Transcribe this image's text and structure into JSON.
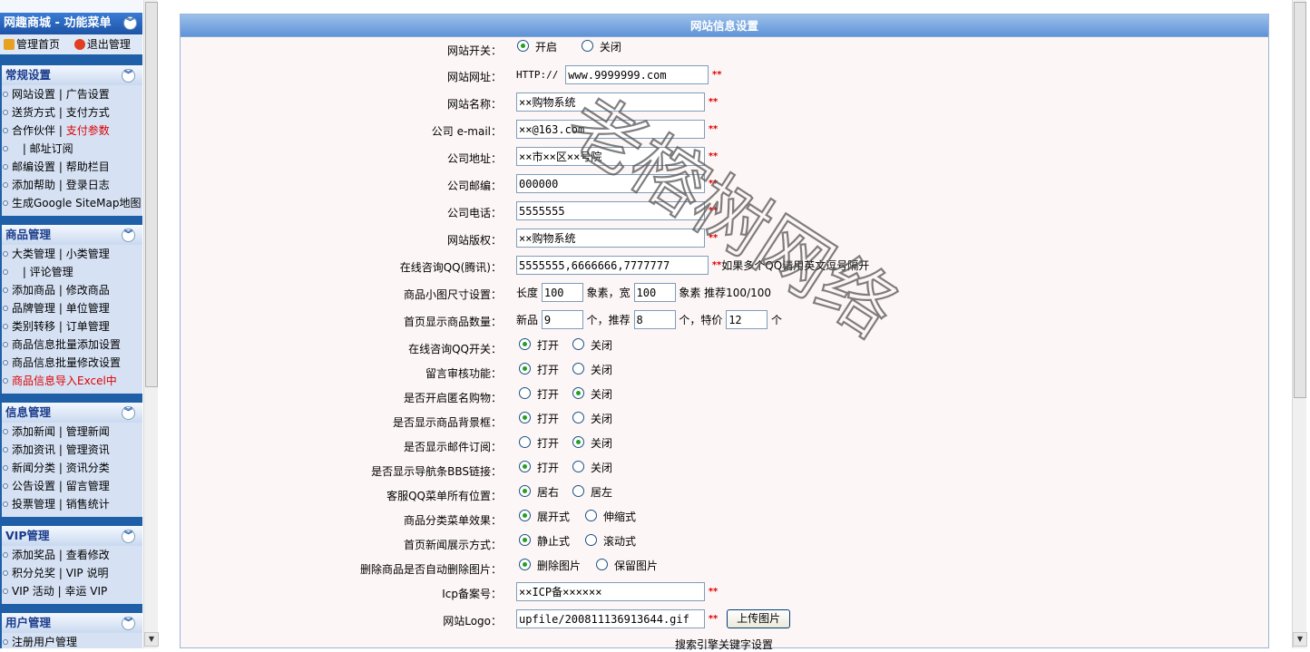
{
  "sidebar": {
    "title": "网趣商城 - 功能菜单",
    "top_links": [
      {
        "label": "管理首页",
        "icon": "home-icon"
      },
      {
        "label": "退出管理",
        "icon": "exit-icon"
      }
    ],
    "sections": [
      {
        "title": "常规设置",
        "items": [
          {
            "a": "网站设置",
            "b": "广告设置"
          },
          {
            "a": "送货方式",
            "b": "支付方式"
          },
          {
            "a": "合作伙伴",
            "b": "支付参数",
            "b_red": true
          },
          {
            "a": "",
            "b": "邮址订阅"
          },
          {
            "a": "邮编设置",
            "b": "帮助栏目"
          },
          {
            "a": "添加帮助",
            "b": "登录日志"
          },
          {
            "a": "生成Google SiteMap地图"
          }
        ]
      },
      {
        "title": "商品管理",
        "items": [
          {
            "a": "大类管理",
            "b": "小类管理"
          },
          {
            "a": "",
            "b": "评论管理"
          },
          {
            "a": "添加商品",
            "b": "修改商品"
          },
          {
            "a": "品牌管理",
            "b": "单位管理"
          },
          {
            "a": "类别转移",
            "b": "订单管理"
          },
          {
            "a": "商品信息批量添加设置"
          },
          {
            "a": "商品信息批量修改设置"
          },
          {
            "a": "商品信息导入Excel中",
            "a_red": true
          }
        ]
      },
      {
        "title": "信息管理",
        "items": [
          {
            "a": "添加新闻",
            "b": "管理新闻"
          },
          {
            "a": "添加资讯",
            "b": "管理资讯"
          },
          {
            "a": "新闻分类",
            "b": "资讯分类"
          },
          {
            "a": "公告设置",
            "b": "留言管理"
          },
          {
            "a": "投票管理",
            "b": "销售统计"
          }
        ]
      },
      {
        "title": "VIP管理",
        "items": [
          {
            "a": "添加奖品",
            "b": "查看修改"
          },
          {
            "a": "积分兑奖",
            "b": "VIP 说明"
          },
          {
            "a": "VIP 活动",
            "b": "幸运 VIP"
          }
        ]
      },
      {
        "title": "用户管理",
        "items": [
          {
            "a": "注册用户管理"
          }
        ]
      }
    ]
  },
  "panel": {
    "title": "网站信息设置",
    "site_switch": {
      "label": "网站开关：",
      "on": "开启",
      "off": "关闭",
      "selected": "on"
    },
    "site_url": {
      "label": "网站网址：",
      "prefix": "HTTP://",
      "value": "www.9999999.com",
      "req": "**"
    },
    "site_name": {
      "label": "网站名称：",
      "value": "××购物系统",
      "req": "**"
    },
    "email": {
      "label": "公司 e-mail：",
      "value": "××@163.com",
      "req": "**"
    },
    "address": {
      "label": "公司地址：",
      "value": "××市××区××号院",
      "req": "**"
    },
    "zip": {
      "label": "公司邮编：",
      "value": "000000",
      "req": "**"
    },
    "phone": {
      "label": "公司电话：",
      "value": "5555555",
      "req": "**"
    },
    "copyright": {
      "label": "网站版权：",
      "value": "××购物系统",
      "req": "**"
    },
    "qq": {
      "label": "在线咨询QQ(腾讯)：",
      "value": "5555555,6666666,7777777",
      "req": "**",
      "note": "如果多个QQ请用英文逗号隔开"
    },
    "thumb_size": {
      "label": "商品小图尺寸设置：",
      "len_label": "长度",
      "len_value": "100",
      "unit1": "象素，宽",
      "wid_value": "100",
      "unit2": "象素 推荐100/100"
    },
    "home_count": {
      "label": "首页显示商品数量：",
      "new_label": "新品",
      "new_value": "9",
      "u1": "个，推荐",
      "rec_value": "8",
      "u2": "个，特价",
      "sp_value": "12",
      "u3": "个"
    },
    "radio_rows": [
      {
        "label": "在线咨询QQ开关：",
        "opt1": "打开",
        "opt2": "关闭",
        "selected": 1
      },
      {
        "label": "留言审核功能：",
        "opt1": "打开",
        "opt2": "关闭",
        "selected": 1
      },
      {
        "label": "是否开启匿名购物：",
        "opt1": "打开",
        "opt2": "关闭",
        "selected": 2
      },
      {
        "label": "是否显示商品背景框：",
        "opt1": "打开",
        "opt2": "关闭",
        "selected": 1
      },
      {
        "label": "是否显示邮件订阅：",
        "opt1": "打开",
        "opt2": "关闭",
        "selected": 2
      },
      {
        "label": "是否显示导航条BBS链接：",
        "opt1": "打开",
        "opt2": "关闭",
        "selected": 1
      },
      {
        "label": "客服QQ菜单所有位置：",
        "opt1": "居右",
        "opt2": "居左",
        "selected": 1
      },
      {
        "label": "商品分类菜单效果：",
        "opt1": "展开式",
        "opt2": "伸缩式",
        "selected": 1
      },
      {
        "label": "首页新闻展示方式：",
        "opt1": "静止式",
        "opt2": "滚动式",
        "selected": 1
      },
      {
        "label": "删除商品是否自动删除图片：",
        "opt1": "删除图片",
        "opt2": "保留图片",
        "selected": 1
      }
    ],
    "icp": {
      "label": "Icp备案号：",
      "value": "××ICP备××××××",
      "req": "**"
    },
    "logo": {
      "label": "网站Logo：",
      "value": "upfile/200811136913644.gif",
      "req": "**",
      "button": "上传图片"
    },
    "seo_heading": "搜索引擎关键字设置"
  },
  "watermark": "老榕树网络",
  "colors": {
    "accent": "#1e5fa8",
    "required": "#dd0000",
    "panel_bg": "#fdf6f6"
  }
}
